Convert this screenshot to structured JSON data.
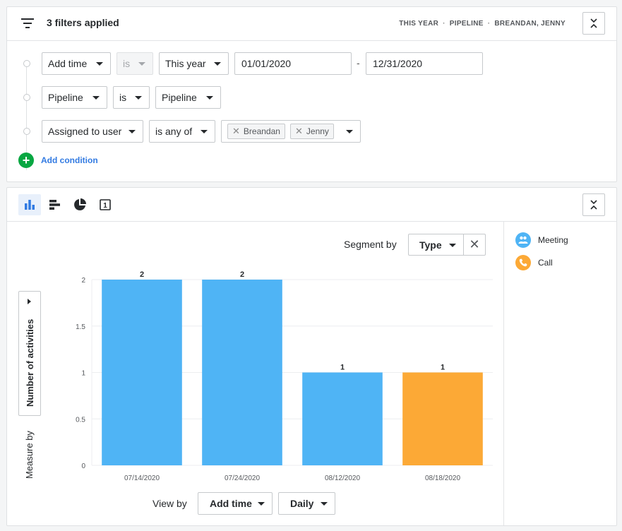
{
  "filter_header": {
    "title": "3 filters applied",
    "summary": [
      "THIS YEAR",
      "PIPELINE",
      "BREANDAN, JENNY"
    ],
    "separator": "·"
  },
  "filters": [
    {
      "field": "Add time",
      "operator": "is",
      "value": "This year",
      "date_from": "01/01/2020",
      "date_sep": "-",
      "date_to": "12/31/2020"
    },
    {
      "field": "Pipeline",
      "operator": "is",
      "value": "Pipeline"
    },
    {
      "field": "Assigned to user",
      "operator": "is any of",
      "chips": [
        "Breandan",
        "Jenny"
      ]
    }
  ],
  "add_condition": "Add condition",
  "chart_toolbar": {
    "icons": [
      "bar-chart-icon",
      "horizontal-bar-icon",
      "pie-chart-icon",
      "scorecard-icon"
    ],
    "scorecard_number": "1"
  },
  "segment": {
    "label": "Segment by",
    "value": "Type"
  },
  "measure": {
    "label": "Number of activities",
    "caption": "Measure by"
  },
  "view_by": {
    "label": "View by",
    "field": "Add time",
    "interval": "Daily"
  },
  "legend": [
    {
      "name": "Meeting",
      "color": "#4fb4f5",
      "icon": "meeting-icon"
    },
    {
      "name": "Call",
      "color": "#fca936",
      "icon": "phone-icon"
    }
  ],
  "chart_data": {
    "type": "bar",
    "categories": [
      "07/14/2020",
      "07/24/2020",
      "08/12/2020",
      "08/18/2020"
    ],
    "series": [
      {
        "name": "Meeting",
        "values": [
          2,
          2,
          1,
          0
        ],
        "color": "#4fb4f5"
      },
      {
        "name": "Call",
        "values": [
          0,
          0,
          0,
          1
        ],
        "color": "#fca936"
      }
    ],
    "data_labels": [
      "2",
      "2",
      "1",
      "1"
    ],
    "yticks": [
      "0",
      "0.5",
      "1",
      "1.5",
      "2"
    ],
    "ylim": [
      0,
      2
    ],
    "ylabel": "Number of activities",
    "xlabel": "",
    "grid": true,
    "legend_position": "right"
  }
}
